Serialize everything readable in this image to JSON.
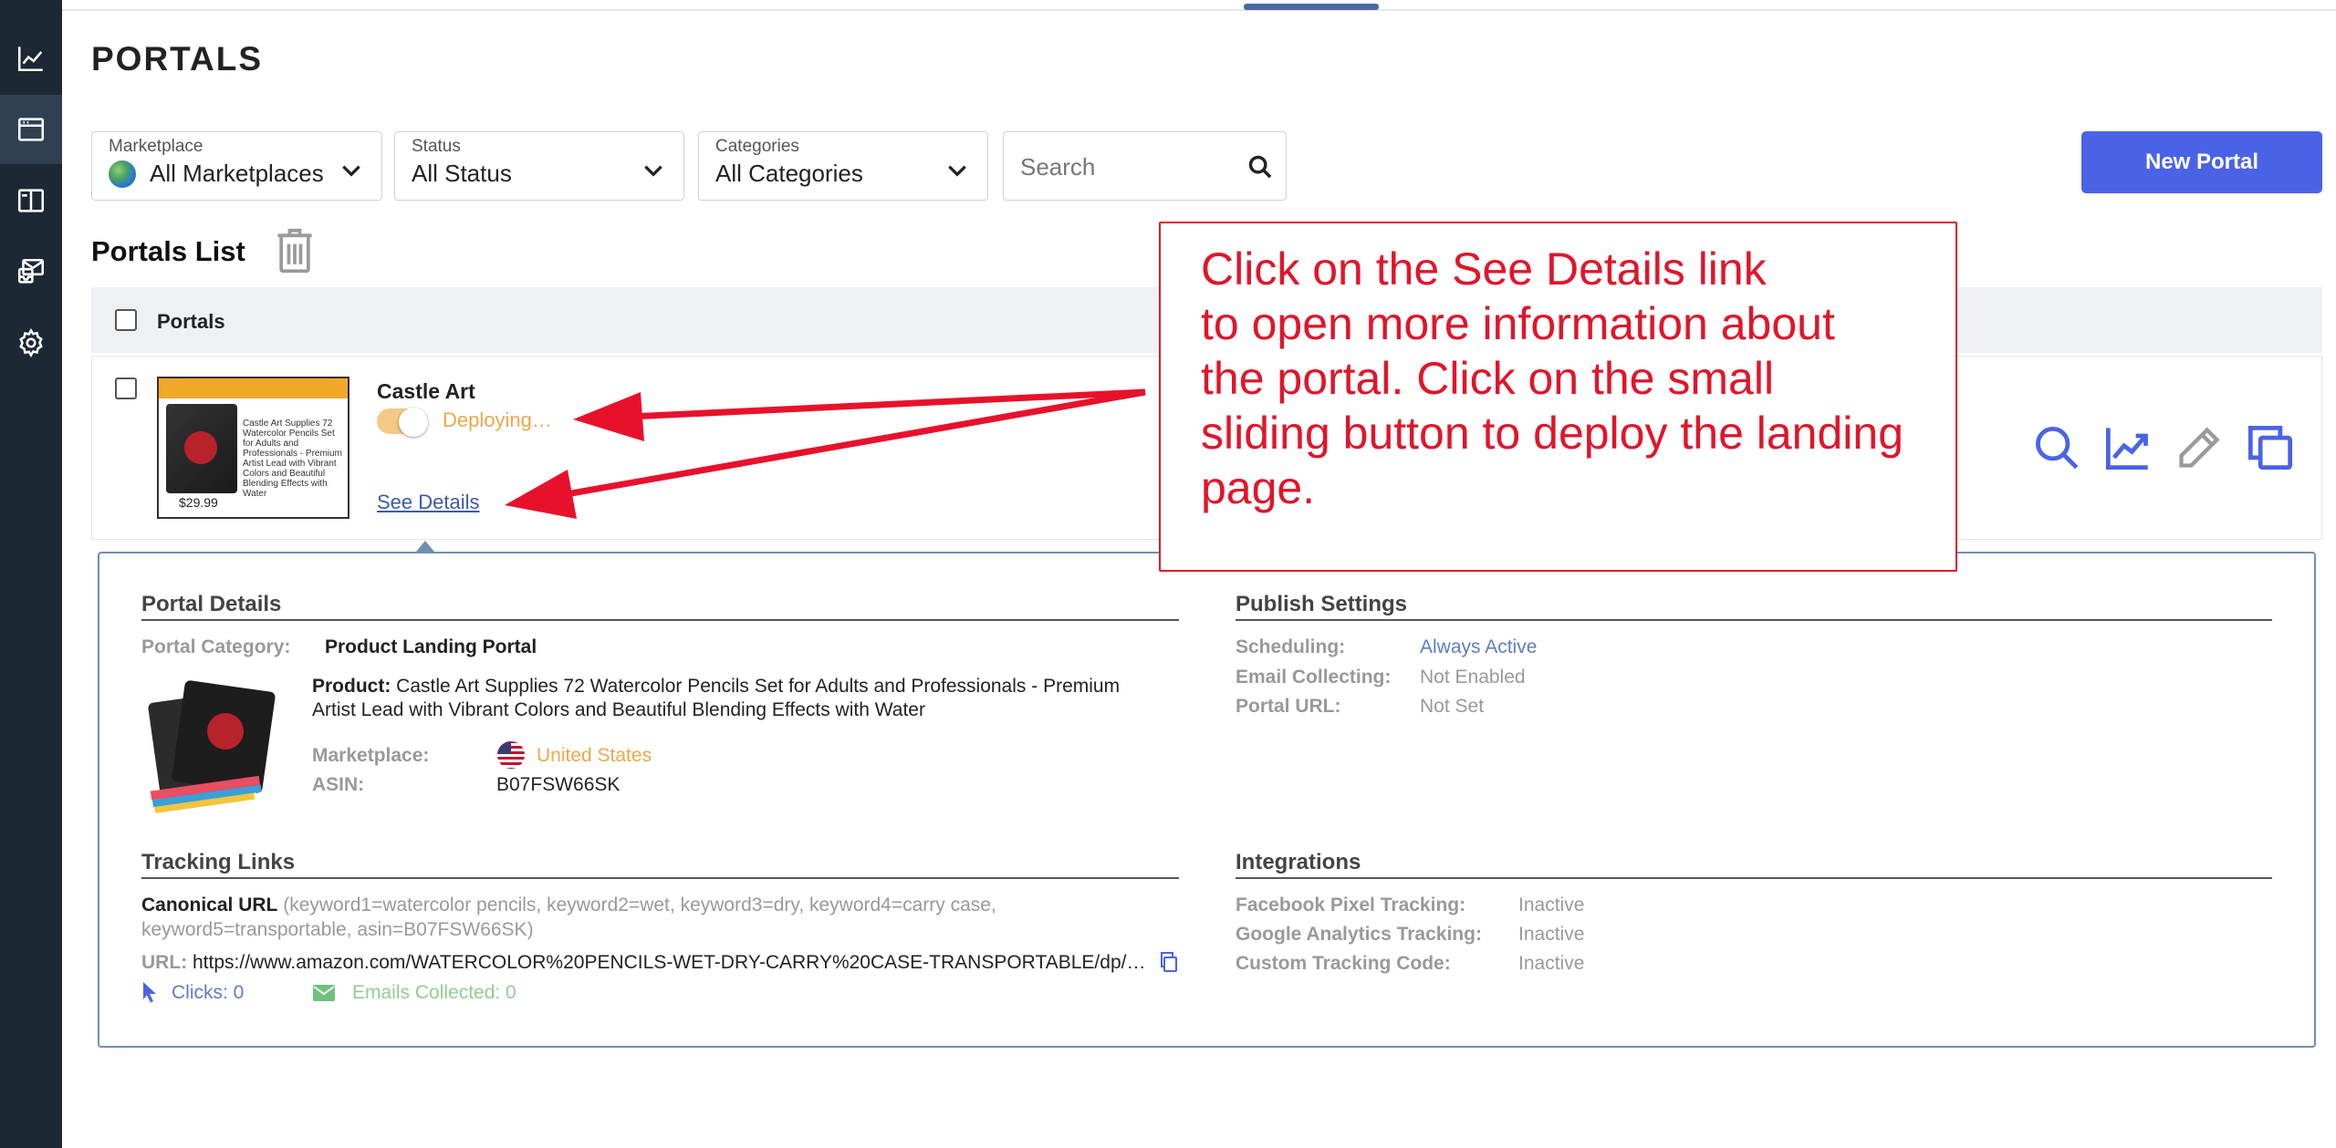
{
  "page": {
    "title": "PORTALS"
  },
  "filters": {
    "marketplace": {
      "label": "Marketplace",
      "value": "All Marketplaces"
    },
    "status": {
      "label": "Status",
      "value": "All Status"
    },
    "categories": {
      "label": "Categories",
      "value": "All Categories"
    },
    "search": {
      "placeholder": "Search"
    }
  },
  "buttons": {
    "new_portal": "New Portal"
  },
  "list": {
    "title": "Portals List",
    "header_label": "Portals",
    "item": {
      "name": "Castle Art",
      "status": "Deploying…",
      "details_link": "See Details",
      "thumb_text": "Castle Art Supplies 72 Watercolor Pencils Set for Adults and Professionals - Premium Artist Lead with Vibrant Colors and Beautiful Blending Effects with Water",
      "thumb_price": "$29.99"
    }
  },
  "details": {
    "portal_details_title": "Portal Details",
    "portal_category_label": "Portal Category:",
    "portal_category_value": "Product Landing Portal",
    "product_label": "Product:",
    "product_value_line1": "Castle Art Supplies 72 Watercolor Pencils Set for Adults and Professionals - Premium",
    "product_value_line2": "Artist Lead with Vibrant Colors and Beautiful Blending Effects with Water",
    "marketplace_label": "Marketplace:",
    "marketplace_value": "United States",
    "asin_label": "ASIN:",
    "asin_value": "B07FSW66SK",
    "publish_title": "Publish Settings",
    "scheduling_label": "Scheduling:",
    "scheduling_value": "Always Active",
    "email_label": "Email Collecting:",
    "email_value": "Not Enabled",
    "url_label": "Portal URL:",
    "url_value": "Not Set",
    "tracking_title": "Tracking Links",
    "canonical_label": "Canonical URL",
    "canonical_value_line1": "(keyword1=watercolor pencils, keyword2=wet, keyword3=dry, keyword4=carry case,",
    "canonical_value_line2": "keyword5=transportable, asin=B07FSW66SK)",
    "link_url_label": "URL:",
    "link_url_value": "https://www.amazon.com/WATERCOLOR%20PENCILS-WET-DRY-CARRY%20CASE-TRANSPORTABLE/dp/…",
    "clicks": "Clicks: 0",
    "emails_collected": "Emails Collected: 0",
    "integrations_title": "Integrations",
    "fb_label": "Facebook Pixel Tracking:",
    "fb_value": "Inactive",
    "ga_label": "Google Analytics Tracking:",
    "ga_value": "Inactive",
    "custom_label": "Custom Tracking Code:",
    "custom_value": "Inactive"
  },
  "callout": {
    "line1": "Click on the See Details link",
    "line2": "to open more information about",
    "line3": "the portal. Click on the small",
    "line4": "sliding button to deploy the landing",
    "line5": "page."
  },
  "colors": {
    "sidebar": "#1c2833",
    "accent": "#4a63e6",
    "deploying": "#e9a84d",
    "annotation": "#e0152b",
    "link": "#3a5ba8"
  }
}
